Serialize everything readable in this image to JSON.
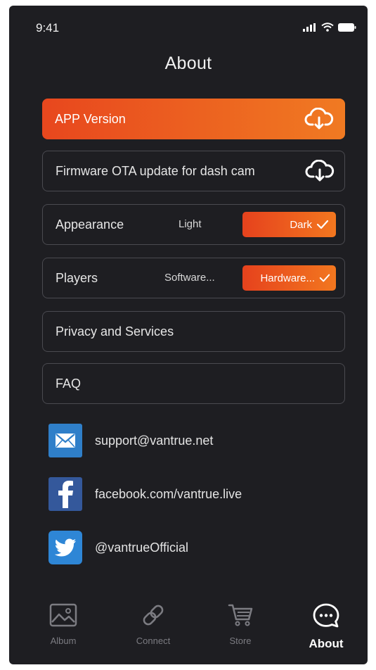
{
  "status": {
    "time": "9:41"
  },
  "page": {
    "title": "About"
  },
  "rows": {
    "app_version": {
      "label": "APP Version",
      "icon": "cloud-download-icon"
    },
    "firmware": {
      "label": "Firmware OTA update for dash cam",
      "icon": "cloud-download-icon"
    },
    "appearance": {
      "label": "Appearance",
      "option_off": "Light",
      "option_on": "Dark"
    },
    "players": {
      "label": "Players",
      "option_off": "Software...",
      "option_on": "Hardware..."
    },
    "privacy": {
      "label": "Privacy and Services"
    },
    "faq": {
      "label": "FAQ"
    }
  },
  "contacts": [
    {
      "icon": "mail-icon",
      "text": "support@vantrue.net",
      "color": "#2f7fc9"
    },
    {
      "icon": "facebook-icon",
      "text": "facebook.com/vantrue.live",
      "color": "#34589b"
    },
    {
      "icon": "twitter-icon",
      "text": "@vantrueOfficial",
      "color": "#2e86d6"
    }
  ],
  "tabs": [
    {
      "label": "Album",
      "icon": "image-icon",
      "active": false
    },
    {
      "label": "Connect",
      "icon": "link-icon",
      "active": false
    },
    {
      "label": "Store",
      "icon": "cart-icon",
      "active": false
    },
    {
      "label": "About",
      "icon": "chat-icon",
      "active": true
    }
  ],
  "colors": {
    "accent": "#ee5a20",
    "background": "#1e1e22",
    "border": "#4a4a50"
  }
}
